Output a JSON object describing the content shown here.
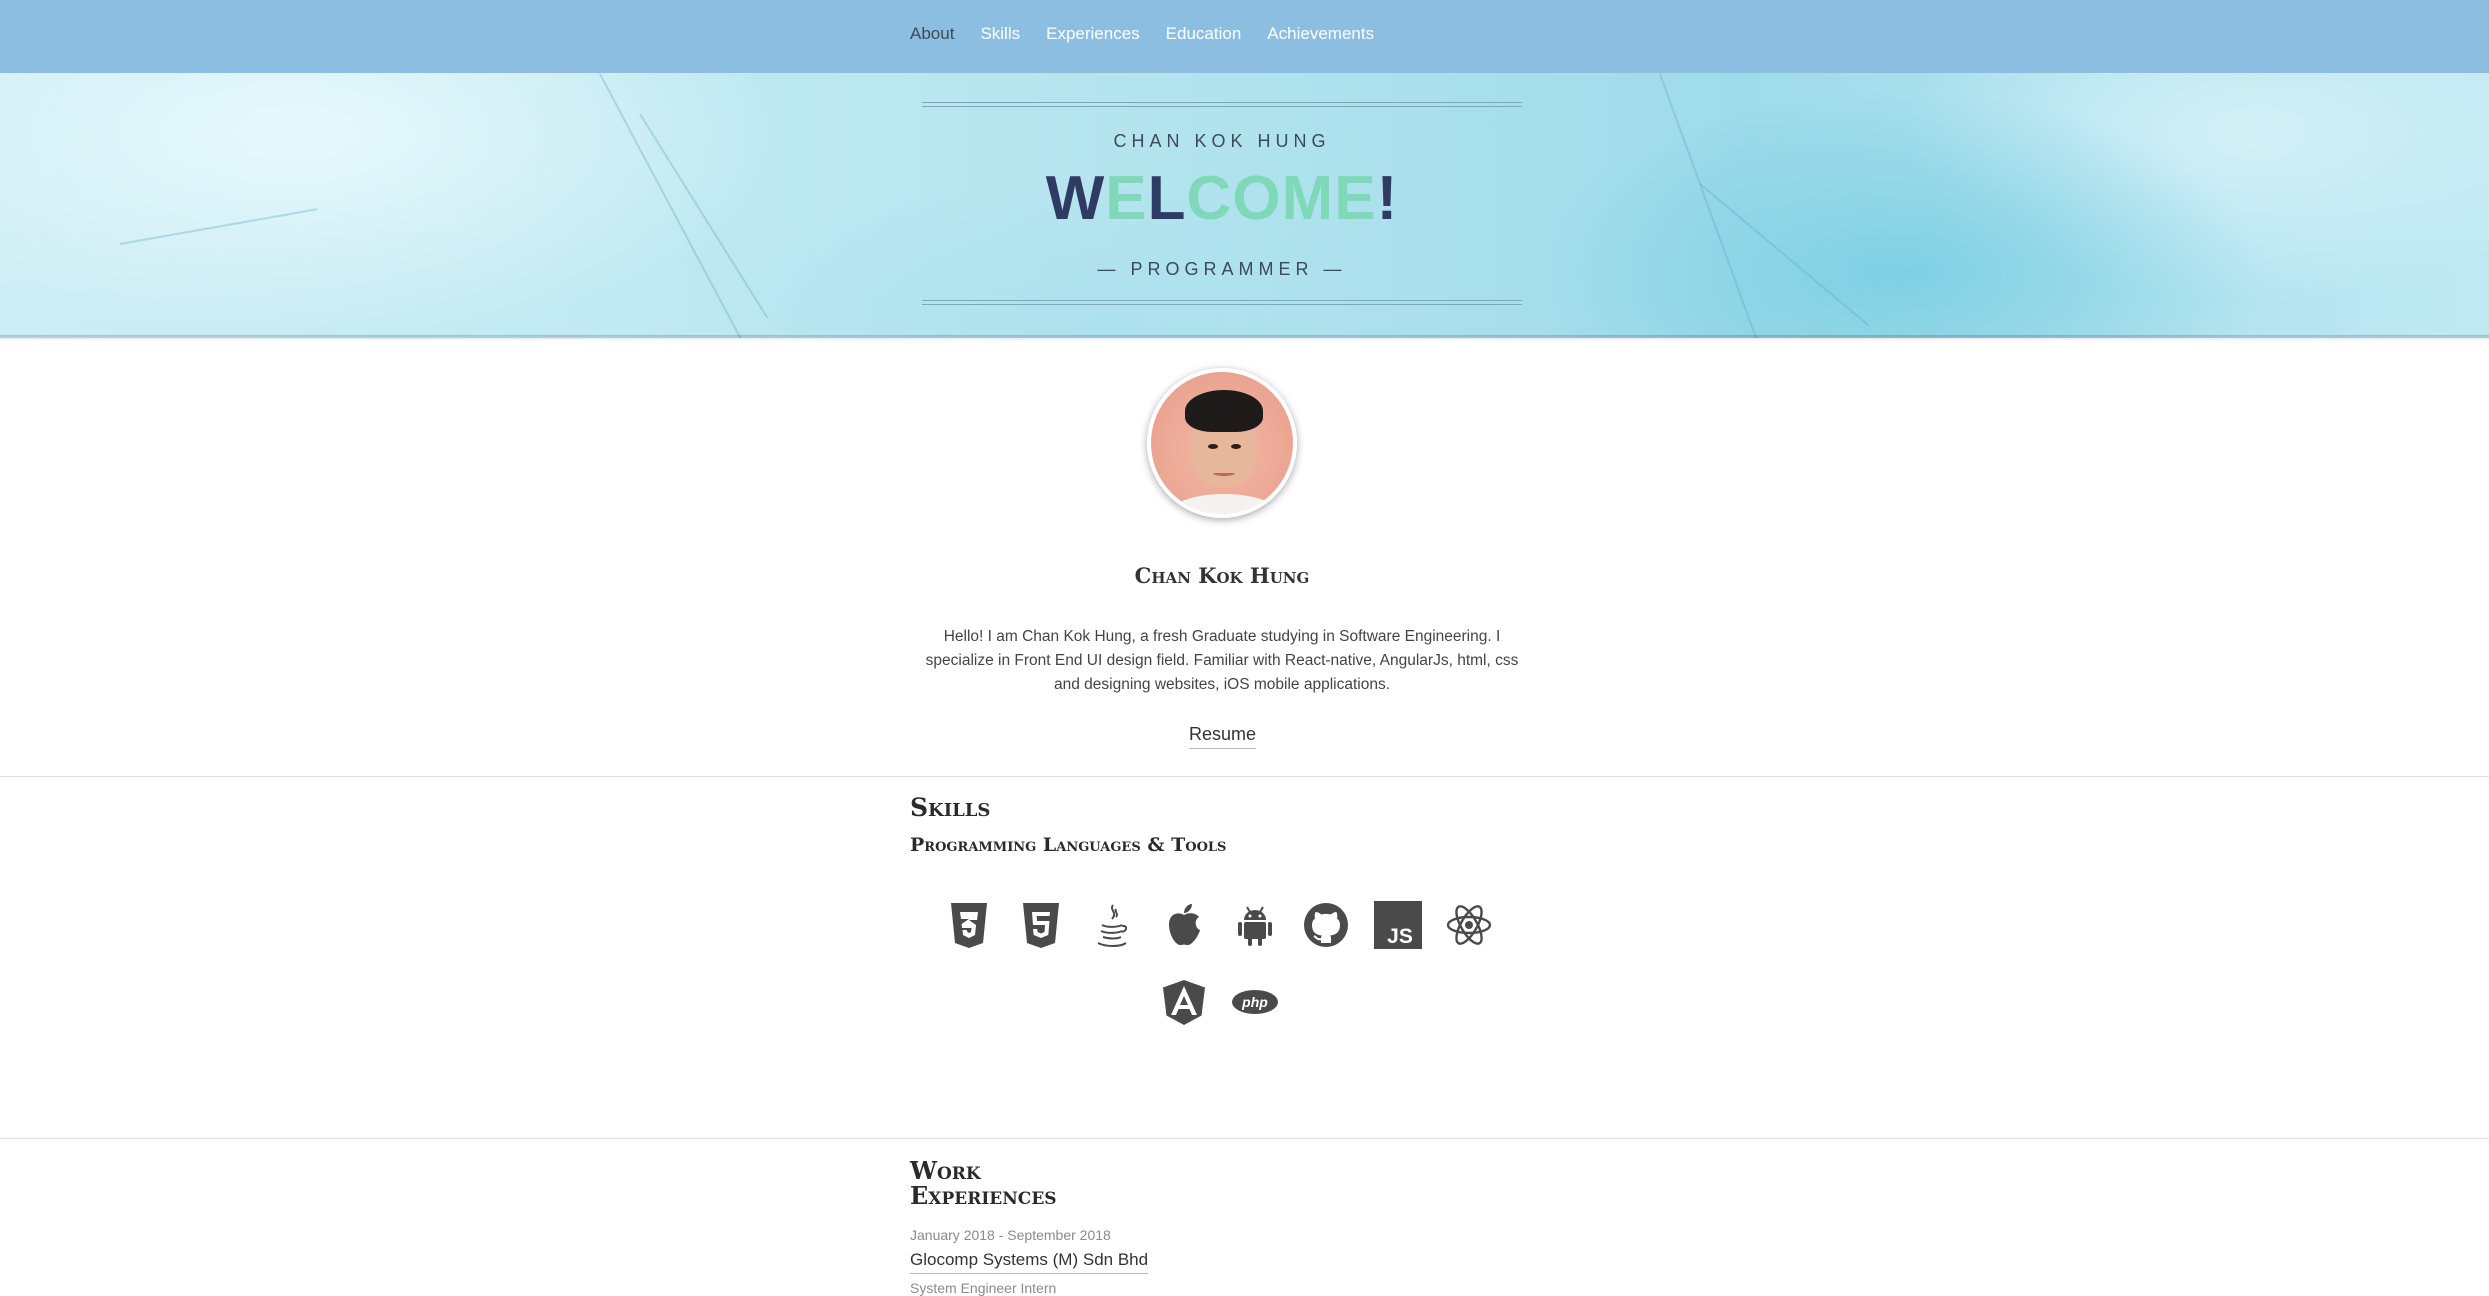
{
  "nav": {
    "items": [
      {
        "label": "About"
      },
      {
        "label": "Skills"
      },
      {
        "label": "Experiences"
      },
      {
        "label": "Education"
      },
      {
        "label": "Achievements"
      }
    ],
    "active": "About"
  },
  "hero": {
    "name": "CHAN KOK HUNG",
    "welcome": "WELCOME!",
    "role": "— PROGRAMMER —",
    "colors": {
      "dark": "#2f3b63",
      "mint": "#7fd8b7"
    }
  },
  "profile": {
    "name": "Chan Kok Hung",
    "bio": "Hello! I am Chan Kok Hung, a fresh Graduate studying in Software Engineering. I specialize in Front End UI design field. Familiar with React-native, AngularJs, html, css and designing websites, iOS mobile applications.",
    "resume_label": "Resume"
  },
  "skills": {
    "title": "Skills",
    "subtitle": "Programming Languages & Tools",
    "icons": [
      "css3-icon",
      "html5-icon",
      "java-icon",
      "apple-icon",
      "android-icon",
      "github-icon",
      "javascript-icon",
      "react-icon",
      "angular-icon",
      "php-icon"
    ]
  },
  "work": {
    "title_line1": "Work",
    "title_line2": "Experiences",
    "entries": [
      {
        "date": "January 2018 - September 2018",
        "company": "Glocomp Systems (M) Sdn Bhd",
        "role": "System Engineer Intern"
      }
    ]
  },
  "colors": {
    "nav_bg": "#8cbee2",
    "hero_bg": "#b8e6ef",
    "icon": "#4a4a4a"
  }
}
